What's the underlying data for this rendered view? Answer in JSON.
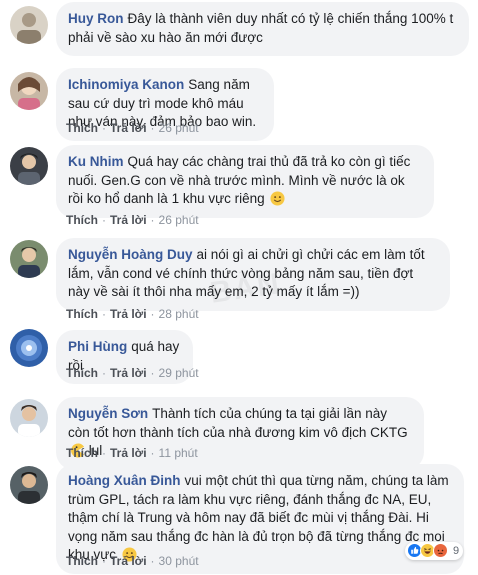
{
  "action_like": "Thích",
  "action_reply": "Trả lời",
  "comments": [
    {
      "author": "Huy Ron",
      "text": "Đây là thành viên duy nhất có tỷ lệ chiến thắng 100% t phải về sào xu hào ăn mới được",
      "time": ""
    },
    {
      "author": "Ichinomiya Kanon",
      "text": "Sang năm sau cứ duy trì mode khô máu như ván này, đảm bảo bao win.",
      "time": "26 phút"
    },
    {
      "author": "Ku Nhim",
      "text": "Quá hay các chàng trai thủ đã trả ko còn gì tiếc nuối. Gen.G con về nhà trước mình. Mình về nước là ok rồi ko hổ danh là 1 khu vực riêng",
      "time": "26 phút"
    },
    {
      "author": "Nguyễn Hoàng Duy",
      "text": "ai nói gì ai chửi gì chửi các em làm tốt lắm, vẫn cond vé chính thức vòng bảng năm sau, tiền đợt này về sài ít thôi nha mấy em, 2 tỷ mấy ít lắm =))",
      "time": "28 phút"
    },
    {
      "author": "Phi Hùng",
      "text": "quá hay rồi",
      "time": "29 phút"
    },
    {
      "author": "Nguyễn Sơn",
      "text": "Thành tích của chúng ta tại giải lần này còn tốt hơn thành tích của nhà đương kim vô địch CKTG",
      "text_after": "lul",
      "time": "11 phút"
    },
    {
      "author": "Hoàng Xuân Đinh",
      "text": "vui một chút thì qua từng năm, chúng ta làm trùm GPL, tách ra làm khu vực riêng, đánh thắng đc NA, EU, thậm chí là Trung và hôm nay đã biết đc mùi vị thắng Đài. Hi vọng năm sau thắng đc hàn là đủ trọn bộ đã từng thắng đc mọi khu vực",
      "time": "30 phút",
      "reaction_count": "9"
    }
  ],
  "watermark": "BẢN",
  "colors": {
    "author": "#385898",
    "bubble": "#f2f3f5",
    "meta": "#606770"
  }
}
